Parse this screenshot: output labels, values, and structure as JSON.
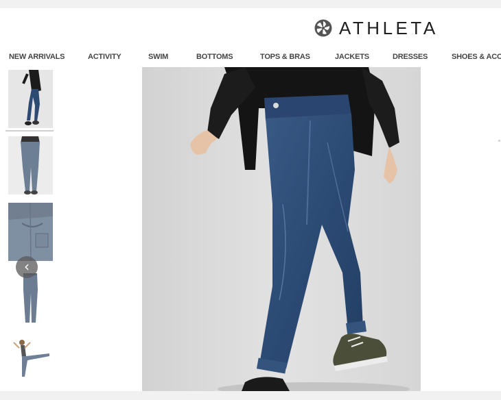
{
  "brand": {
    "name": "ATHLETA",
    "logo_icon": "pinwheel-logo-icon"
  },
  "nav": {
    "items": [
      {
        "label": "NEW ARRIVALS"
      },
      {
        "label": "ACTIVITY"
      },
      {
        "label": "SWIM"
      },
      {
        "label": "BOTTOMS"
      },
      {
        "label": "TOPS & BRAS"
      },
      {
        "label": "JACKETS"
      },
      {
        "label": "DRESSES"
      },
      {
        "label": "SHOES & ACCE"
      }
    ]
  },
  "gallery": {
    "prev_icon": "chevron-left-icon",
    "prev_glyph": "‹",
    "thumbnails": [
      {
        "subject": "full-length side view in jeans and black cardigan",
        "selected": true
      },
      {
        "subject": "back view of legs in light jeans",
        "selected": false
      },
      {
        "subject": "close-up of grey denim fabric",
        "selected": false
      },
      {
        "subject": "jeans laid flat",
        "selected": false
      },
      {
        "subject": "dancer pose with leg raised",
        "selected": false
      }
    ],
    "main_subject": "model walking in dark wash skinny jeans, black cardigan and sneakers"
  },
  "colors": {
    "denim": "#2d4a73",
    "cardigan": "#1a1a1a",
    "background": "#d8d8d8",
    "nav_text": "#444444"
  }
}
